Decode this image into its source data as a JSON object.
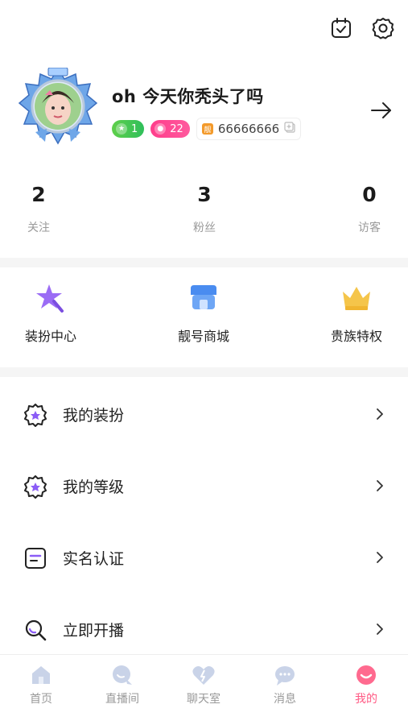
{
  "header": {
    "icons": [
      "calendar-check-icon",
      "gear-icon"
    ]
  },
  "profile": {
    "nickname": "oh 今天你秃头了吗",
    "level_badge": "1",
    "pink_badge": "22",
    "user_id": "66666666"
  },
  "stats": [
    {
      "value": "2",
      "label": "关注"
    },
    {
      "value": "3",
      "label": "粉丝"
    },
    {
      "value": "0",
      "label": "访客"
    }
  ],
  "features": [
    {
      "label": "装扮中心",
      "icon": "star-wand-icon"
    },
    {
      "label": "靓号商城",
      "icon": "shop-icon"
    },
    {
      "label": "贵族特权",
      "icon": "crown-icon"
    }
  ],
  "menu": [
    {
      "label": "我的装扮",
      "icon": "badge-icon"
    },
    {
      "label": "我的等级",
      "icon": "level-badge-icon"
    },
    {
      "label": "实名认证",
      "icon": "id-card-icon"
    },
    {
      "label": "立即开播",
      "icon": "search-live-icon"
    }
  ],
  "tabbar": [
    {
      "label": "首页",
      "icon": "home-icon"
    },
    {
      "label": "直播间",
      "icon": "live-room-icon"
    },
    {
      "label": "聊天室",
      "icon": "chat-room-icon"
    },
    {
      "label": "消息",
      "icon": "message-icon"
    },
    {
      "label": "我的",
      "icon": "me-icon",
      "active": true
    }
  ],
  "colors": {
    "accent_pink": "#ff5a84",
    "badge_green": "#3cc454",
    "badge_pink": "#ff3d8b",
    "feature_purple": "#8b5cf6",
    "feature_blue": "#4a8cf0",
    "feature_gold": "#f5c54a"
  }
}
